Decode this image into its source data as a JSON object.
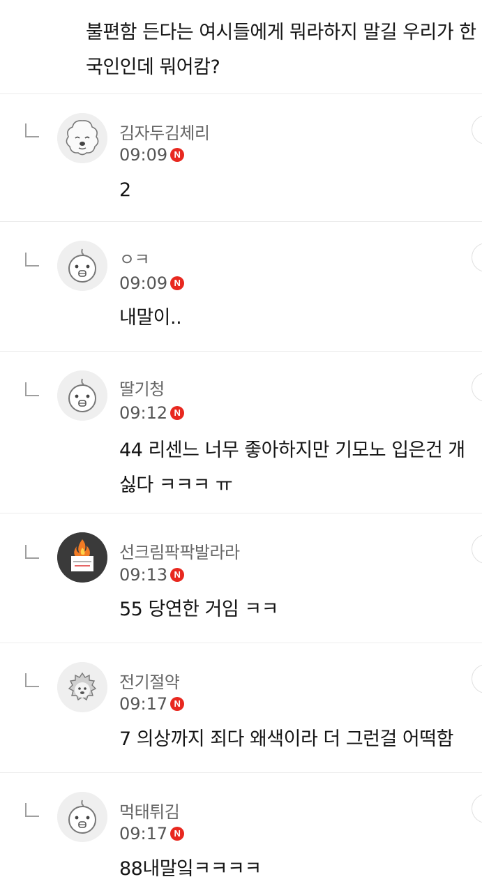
{
  "top_comment": {
    "text": "불편함 든다는 여시들에게 뭐라하지 말길 우리가 한국인인데 뭐어캄?"
  },
  "badge_label": "N",
  "replies": [
    {
      "nickname": "김자두김체리",
      "time": "09:09",
      "text": "2"
    },
    {
      "nickname": "ㅇㅋ",
      "time": "09:09",
      "text": "내말이.."
    },
    {
      "nickname": "딸기청",
      "time": "09:12",
      "text": "44 리센느 너무 좋아하지만 기모노 입은건 개싫다 ㅋㅋㅋ ㅠ"
    },
    {
      "nickname": "선크림팍팍발라라",
      "time": "09:13",
      "text": "55 당연한 거임 ㅋㅋ"
    },
    {
      "nickname": "전기절약",
      "time": "09:17",
      "text": "7 의상까지 죄다 왜색이라 더 그런걸 어떡함"
    },
    {
      "nickname": "먹태튀김",
      "time": "09:17",
      "text": "88내말잌ㅋㅋㅋㅋ"
    }
  ],
  "colors": {
    "badge": "#e8281f",
    "divider": "#ececec",
    "nickname": "#666666"
  },
  "icons": [
    "reply-arrow-icon",
    "poodle-avatar-icon",
    "bald-character-avatar-icon",
    "candle-avatar-icon",
    "hedgehog-avatar-icon",
    "more-options-icon",
    "new-badge-icon"
  ]
}
